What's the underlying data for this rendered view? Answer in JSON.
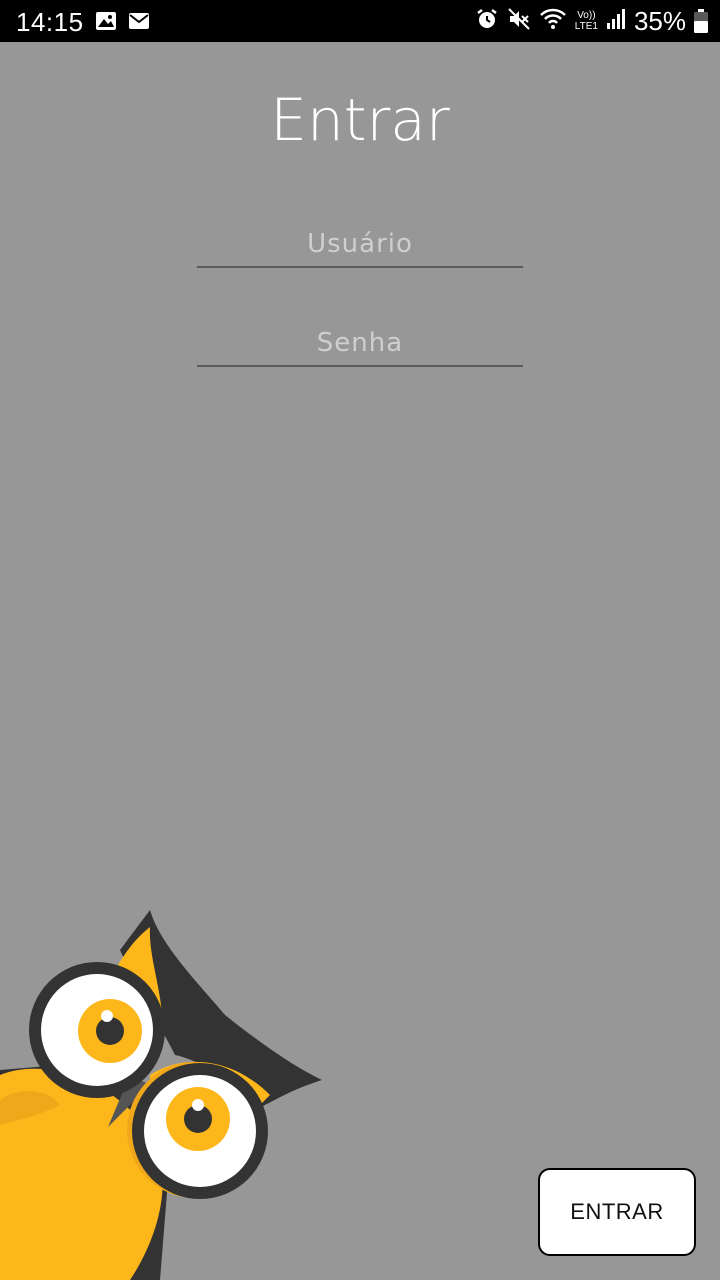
{
  "status_bar": {
    "time": "14:15",
    "battery_percent": "35%",
    "icons": [
      "image-icon",
      "mail-icon",
      "alarm-icon",
      "mute-icon",
      "wifi-icon",
      "volte-lte-icon",
      "signal-icon",
      "battery-icon"
    ]
  },
  "login": {
    "title": "Entrar",
    "username_placeholder": "Usuário",
    "password_placeholder": "Senha",
    "submit_label": "ENTRAR"
  },
  "colors": {
    "background": "#979797",
    "owl_yellow": "#FDB71A",
    "owl_dark": "#333333"
  }
}
